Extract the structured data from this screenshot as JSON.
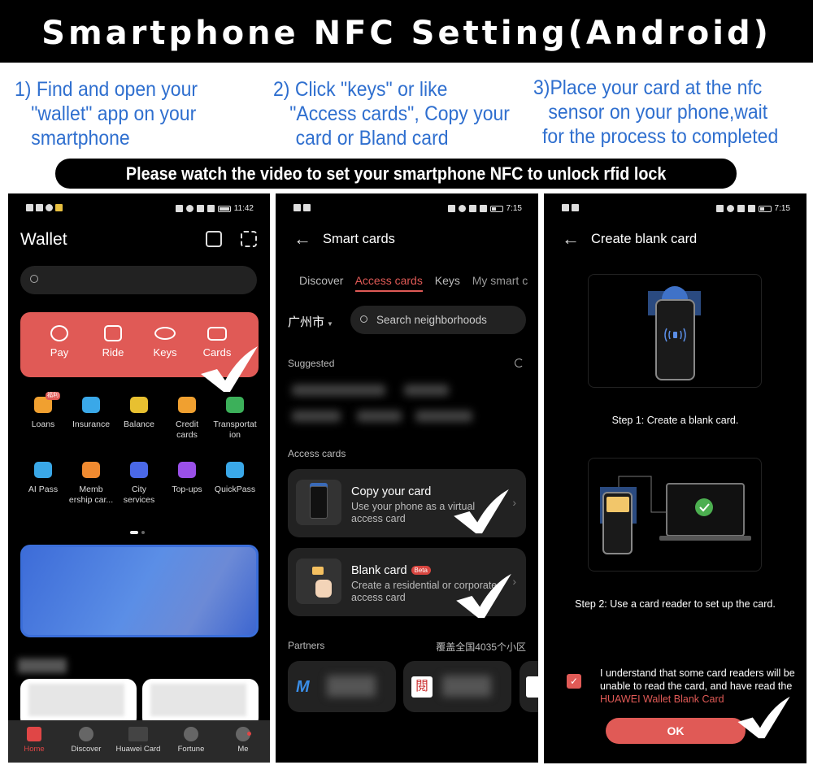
{
  "header": {
    "title": "Smartphone NFC Setting(Android)"
  },
  "steps": [
    {
      "lines": [
        "1) Find and open your",
        "  \"wallet\" app on your",
        "  smartphone"
      ]
    },
    {
      "lines": [
        "2) Click \"keys\" or like",
        "  \"Access cards\", Copy your",
        "  card or Bland card"
      ]
    },
    {
      "lines": [
        "3)Place your card at the nfc",
        "  sensor on your phone,wait",
        " for the process to completed"
      ]
    }
  ],
  "video_banner": "Please watch the video to set your smartphone NFC to unlock rfid lock",
  "phone1": {
    "status_time": "11:42",
    "title": "Wallet",
    "header_icons": [
      "qr-code-icon",
      "scan-icon"
    ],
    "search_placeholder": "",
    "quick_actions": [
      {
        "label": "Pay",
        "icon": "pay-icon"
      },
      {
        "label": "Ride",
        "icon": "bus-icon"
      },
      {
        "label": "Keys",
        "icon": "key-icon"
      },
      {
        "label": "Cards",
        "icon": "card-icon"
      }
    ],
    "services": [
      {
        "label": "Loans",
        "icon": "loans-icon",
        "color": "#f0a030",
        "badge": "福利"
      },
      {
        "label": "Insurance",
        "icon": "umbrella-icon",
        "color": "#3aa8e8"
      },
      {
        "label": "Balance",
        "icon": "coin-icon",
        "color": "#e8c030"
      },
      {
        "label": "Credit\ncards",
        "icon": "credit-card-icon",
        "color": "#f0a030"
      },
      {
        "label": "Transportat\nion",
        "icon": "transport-icon",
        "color": "#3cb05a"
      },
      {
        "label": "AI Pass",
        "icon": "ai-pass-icon",
        "color": "#3aa8e8"
      },
      {
        "label": "Memb\nership car...",
        "icon": "vip-icon",
        "color": "#f08a30"
      },
      {
        "label": "City\nservices",
        "icon": "city-services-icon",
        "color": "#4a68e8"
      },
      {
        "label": "Top-ups",
        "icon": "top-up-icon",
        "color": "#9a50e8"
      },
      {
        "label": "QuickPass",
        "icon": "quickpass-icon",
        "color": "#3aa8e8"
      }
    ],
    "nav": [
      {
        "label": "Home",
        "icon": "home-icon",
        "active": true
      },
      {
        "label": "Discover",
        "icon": "discover-icon"
      },
      {
        "label": "Huawei Card",
        "icon": "huawei-card-icon"
      },
      {
        "label": "Fortune",
        "icon": "fortune-icon"
      },
      {
        "label": "Me",
        "icon": "profile-icon"
      }
    ]
  },
  "phone2": {
    "status_time": "7:15",
    "title": "Smart cards",
    "tabs": [
      "Discover",
      "Access cards",
      "Keys",
      "My smart c"
    ],
    "active_tab": "Access cards",
    "city": "广州市",
    "search_placeholder": "Search neighborhoods",
    "suggested_label": "Suggested",
    "access_cards_label": "Access cards",
    "cards": [
      {
        "title": "Copy your card",
        "desc": "Use your phone as a virtual access card"
      },
      {
        "title": "Blank card",
        "badge": "Beta",
        "desc": "Create a residential or corporate access card"
      }
    ],
    "partners_label": "Partners",
    "partners_meta": "覆盖全国4035个小区"
  },
  "phone3": {
    "status_time": "7:15",
    "title": "Create blank card",
    "step1": "Step 1: Create a blank card.",
    "step2": "Step 2: Use a card reader to set up the card.",
    "agree_text": "I understand that some card readers will be unable to read the card, and have read the ",
    "agree_link": "HUAWEI Wallet Blank Card",
    "agree_checked": true,
    "ok_label": "OK"
  },
  "colors": {
    "accent_red": "#e05a56",
    "step_blue": "#2f6fcf"
  }
}
